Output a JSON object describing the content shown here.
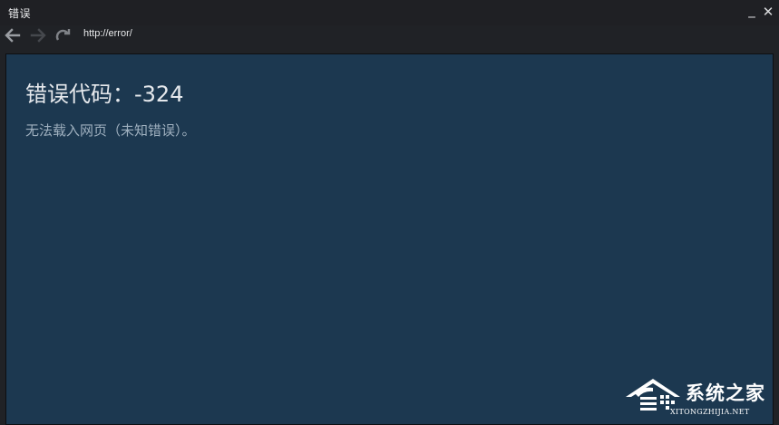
{
  "window": {
    "title": "错误",
    "minimize_glyph": "_",
    "close_glyph": "✕"
  },
  "toolbar": {
    "back_icon": "arrow-left-icon",
    "forward_icon": "arrow-right-icon",
    "reload_icon": "reload-icon",
    "url": "http://error/"
  },
  "content": {
    "heading": "错误代码：-324",
    "description": "无法载入网页（未知错误）。"
  },
  "watermark": {
    "text": "系统之家",
    "subtext": "XITONGZHIJIA.NET"
  },
  "colors": {
    "titlebar_bg": "#1f2024",
    "content_bg": "#1c3850",
    "heading": "#e5e8ec",
    "description": "#9fb0bf"
  }
}
